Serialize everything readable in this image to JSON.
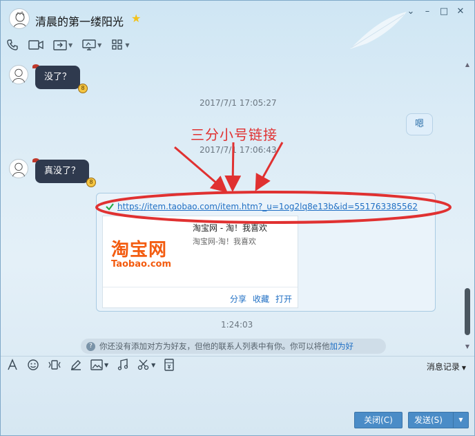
{
  "title": {
    "contact_name": "清晨的第一缕阳光"
  },
  "toolbar": {
    "items": [
      "phone-icon",
      "video-icon",
      "screen-share-icon",
      "remote-desktop-icon",
      "apps-icon"
    ]
  },
  "messages": [
    {
      "from": "contact",
      "text": "没了？"
    },
    {
      "timestamp": "2017/7/1 17:05:27"
    },
    {
      "from": "me",
      "text": "嗯"
    },
    {
      "timestamp": "2017/7/1 17:06:43"
    },
    {
      "from": "contact",
      "text": "真没了？"
    }
  ],
  "annotation": "三分小号链接",
  "link_card": {
    "url": "https://item.taobao.com/item.htm?_u=1og2lq8e13b&id=551763385562",
    "preview_title": "淘宝网 - 淘！我喜欢",
    "preview_desc": "淘宝网-淘！我喜欢",
    "logo_cn": "淘宝网",
    "logo_en": "Taobao.com",
    "actions": {
      "share": "分享",
      "collect": "收藏",
      "open": "打开"
    }
  },
  "last_timestamp": "1:24:03",
  "notice": {
    "text": "你还没有添加对方为好友，但他的联系人列表中有你。你可以将他",
    "link": "加为好"
  },
  "input_toolbar": {
    "history": "消息记录"
  },
  "buttons": {
    "close": "关闭(C)",
    "send": "发送(S)"
  },
  "colors": {
    "accent": "#4a8cc7",
    "bubble_dark": "#2f3a4e",
    "annotation": "#e03131",
    "link": "#1f6fc4"
  }
}
